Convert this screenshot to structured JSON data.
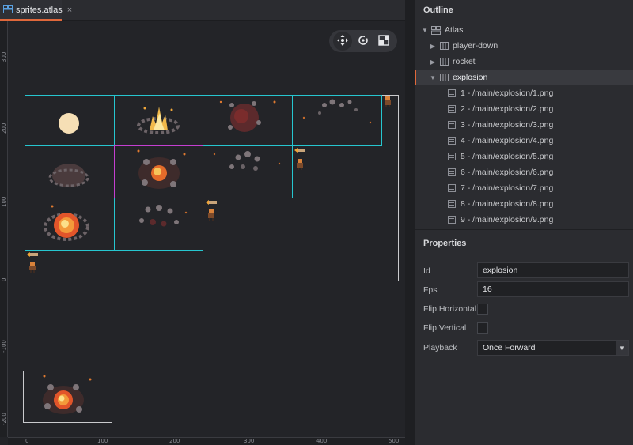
{
  "tab": {
    "label": "sprites.atlas",
    "close": "×"
  },
  "rulers": {
    "left": [
      "300",
      "200",
      "100",
      "0",
      "-100",
      "-200"
    ],
    "bottom": [
      "0",
      "100",
      "200",
      "300",
      "400",
      "500"
    ]
  },
  "toolbar": {
    "move_icon": "move-icon",
    "rotate_icon": "rotate-icon",
    "scale_icon": "scale-icon"
  },
  "outline": {
    "title": "Outline",
    "root": "Atlas",
    "items": [
      {
        "label": "player-down",
        "expanded": false
      },
      {
        "label": "rocket",
        "expanded": false
      },
      {
        "label": "explosion",
        "expanded": true,
        "selected": true
      }
    ],
    "frames": [
      "1 - /main/explosion/1.png",
      "2 - /main/explosion/2.png",
      "3 - /main/explosion/3.png",
      "4 - /main/explosion/4.png",
      "5 - /main/explosion/5.png",
      "6 - /main/explosion/6.png",
      "7 - /main/explosion/7.png",
      "8 - /main/explosion/8.png",
      "9 - /main/explosion/9.png"
    ]
  },
  "properties": {
    "title": "Properties",
    "id_label": "Id",
    "id_value": "explosion",
    "fps_label": "Fps",
    "fps_value": "16",
    "flip_h_label": "Flip Horizontal",
    "flip_h_checked": false,
    "flip_v_label": "Flip Vertical",
    "flip_v_checked": false,
    "playback_label": "Playback",
    "playback_value": "Once Forward"
  },
  "colors": {
    "accent": "#e0683b",
    "cell_border": "#26c6cf",
    "selected_cell_border": "#c43fd0"
  }
}
